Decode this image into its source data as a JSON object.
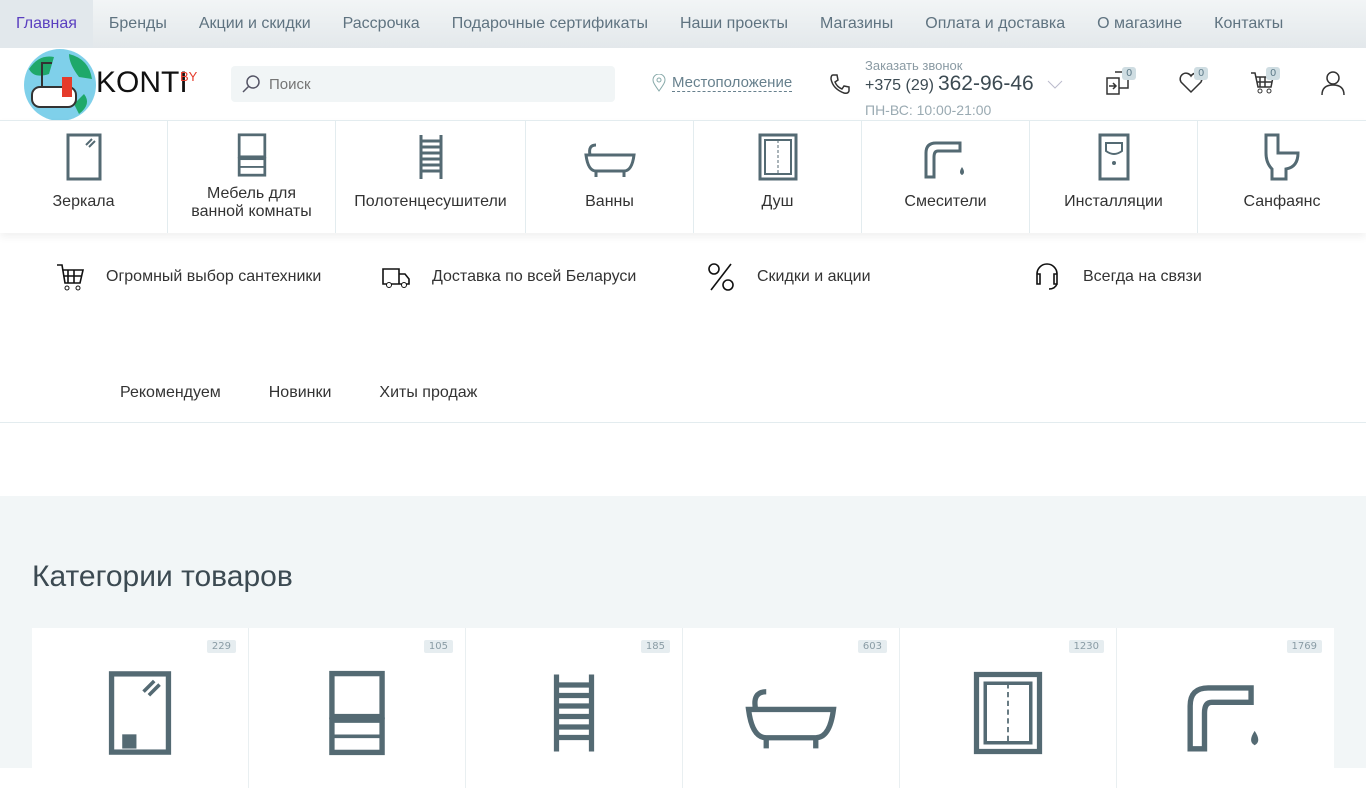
{
  "topnav": [
    "Главная",
    "Бренды",
    "Акции и скидки",
    "Рассрочка",
    "Подарочные сертификаты",
    "Наши проекты",
    "Магазины",
    "Оплата и доставка",
    "О магазине",
    "Контакты"
  ],
  "logo": {
    "text": "KONTI",
    "sup": "BY"
  },
  "search": {
    "placeholder": "Поиск"
  },
  "location": "Местоположение",
  "phone": {
    "callback": "Заказать звонок",
    "code": "+375 (29)",
    "number": "362-96-46",
    "hours": "ПН-ВС: 10:00-21:00"
  },
  "badges": {
    "compare": "0",
    "favorites": "0",
    "cart": "0"
  },
  "categories": [
    "Зеркала",
    "Мебель для ванной комнаты",
    "Полотенцесушители",
    "Ванны",
    "Душ",
    "Смесители",
    "Инсталляции",
    "Санфаянс"
  ],
  "features": [
    "Огромный выбор сантехники",
    "Доставка по всей Беларуси",
    "Скидки и акции",
    "Всегда на связи"
  ],
  "tabs": [
    "Рекомендуем",
    "Новинки",
    "Хиты продаж"
  ],
  "section_title": "Категории товаров",
  "card_counts": [
    "229",
    "105",
    "185",
    "603",
    "1230",
    "1769"
  ],
  "colors": {
    "accent": "#5a3fc0",
    "icon": "#546a73",
    "bg": "#f2f6f7"
  }
}
